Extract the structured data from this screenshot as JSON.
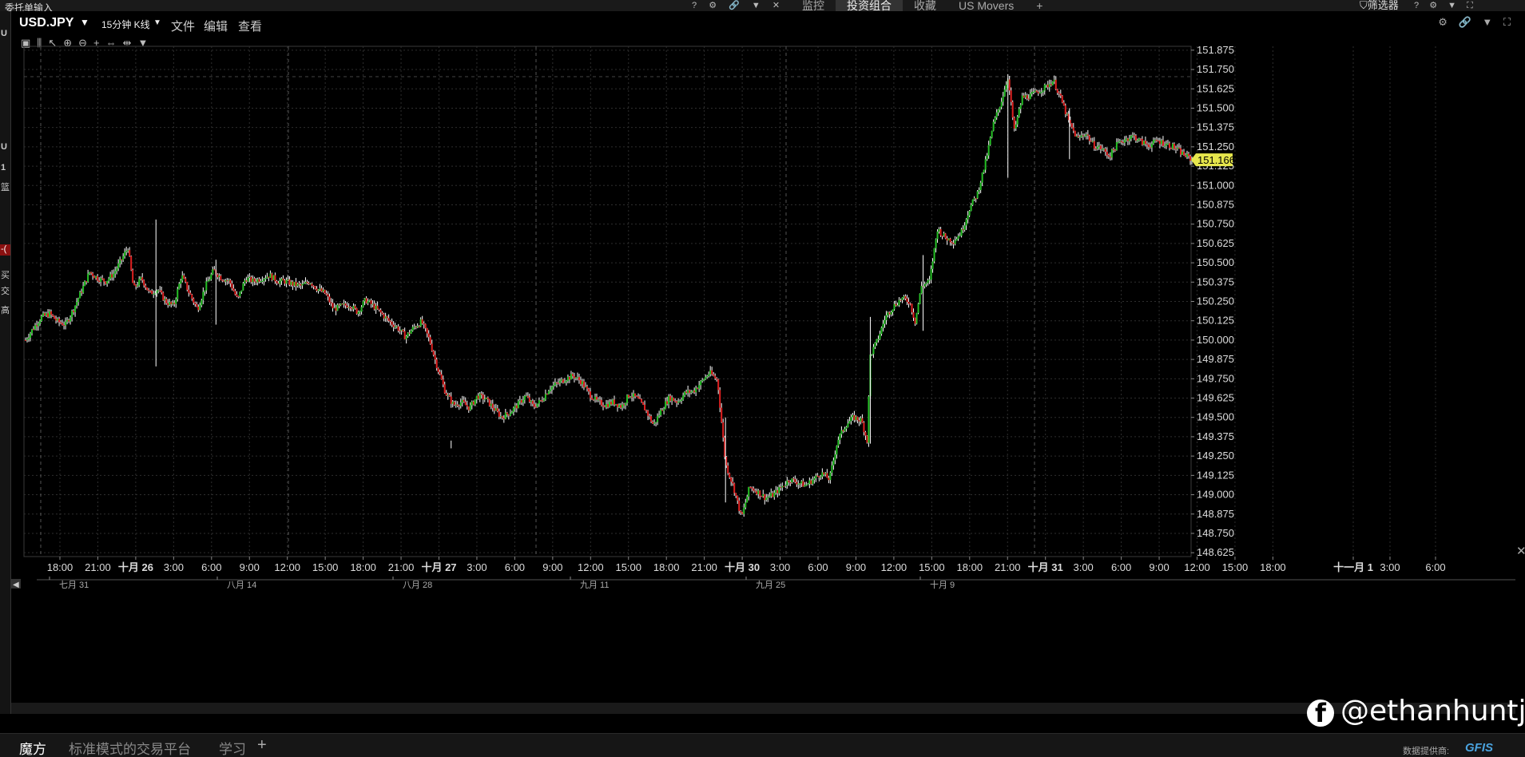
{
  "topbar": {
    "title": "委托单输入",
    "tabs": [
      {
        "label": "监控",
        "active": false
      },
      {
        "label": "投资组合",
        "active": true
      },
      {
        "label": "收藏",
        "active": false
      },
      {
        "label": "US Movers",
        "active": false
      }
    ],
    "screener_label": "筛选器"
  },
  "left_strip": {
    "texts": [
      "U",
      "1",
      "篮",
      "-(",
      "买",
      "交",
      "高"
    ]
  },
  "header": {
    "symbol": "USD.JPY",
    "interval": "15分钟 K线",
    "menus": [
      "文件",
      "编辑",
      "查看"
    ]
  },
  "chart_data": {
    "type": "candlestick",
    "symbol": "USD.JPY",
    "last_price": "151.166",
    "ylim": [
      148.6,
      151.9
    ],
    "y_ticks": [
      "151.875",
      "151.750",
      "151.625",
      "151.500",
      "151.375",
      "151.250",
      "151.125",
      "151.000",
      "150.875",
      "150.750",
      "150.625",
      "150.500",
      "150.375",
      "150.250",
      "150.125",
      "150.000",
      "149.875",
      "149.750",
      "149.625",
      "149.500",
      "149.375",
      "149.250",
      "149.125",
      "149.000",
      "148.875",
      "148.750",
      "148.625"
    ],
    "x_ticks": [
      "18:00",
      "21:00",
      "十月 26",
      "3:00",
      "6:00",
      "9:00",
      "12:00",
      "15:00",
      "18:00",
      "21:00",
      "十月 27",
      "3:00",
      "6:00",
      "9:00",
      "12:00",
      "15:00",
      "18:00",
      "21:00",
      "十月 30",
      "3:00",
      "6:00",
      "9:00",
      "12:00",
      "15:00",
      "18:00",
      "21:00",
      "十月 31",
      "3:00",
      "6:00",
      "9:00",
      "12:00",
      "15:00",
      "18:00",
      "十一月 1",
      "3:00",
      "6:00"
    ],
    "overview_labels": [
      "七月 31",
      "八月 14",
      "八月 28",
      "九月 11",
      "九月 25",
      "十月 9"
    ],
    "price_path": [
      [
        0,
        150.0
      ],
      [
        10,
        150.08
      ],
      [
        20,
        150.15
      ],
      [
        30,
        150.17
      ],
      [
        40,
        150.12
      ],
      [
        50,
        150.1
      ],
      [
        60,
        150.2
      ],
      [
        70,
        150.32
      ],
      [
        80,
        150.44
      ],
      [
        90,
        150.4
      ],
      [
        100,
        150.38
      ],
      [
        110,
        150.43
      ],
      [
        120,
        150.52
      ],
      [
        128,
        150.6
      ],
      [
        135,
        150.33
      ],
      [
        145,
        150.4
      ],
      [
        155,
        150.3
      ],
      [
        165,
        150.33
      ],
      [
        175,
        150.25
      ],
      [
        185,
        150.22
      ],
      [
        195,
        150.42
      ],
      [
        205,
        150.3
      ],
      [
        215,
        150.2
      ],
      [
        225,
        150.35
      ],
      [
        235,
        150.45
      ],
      [
        245,
        150.4
      ],
      [
        255,
        150.38
      ],
      [
        265,
        150.26
      ],
      [
        275,
        150.4
      ],
      [
        285,
        150.38
      ],
      [
        295,
        150.4
      ],
      [
        305,
        150.42
      ],
      [
        315,
        150.38
      ],
      [
        325,
        150.38
      ],
      [
        335,
        150.36
      ],
      [
        345,
        150.35
      ],
      [
        355,
        150.38
      ],
      [
        365,
        150.33
      ],
      [
        375,
        150.3
      ],
      [
        385,
        150.2
      ],
      [
        395,
        150.22
      ],
      [
        405,
        150.23
      ],
      [
        415,
        150.18
      ],
      [
        425,
        150.26
      ],
      [
        435,
        150.22
      ],
      [
        445,
        150.17
      ],
      [
        455,
        150.12
      ],
      [
        465,
        150.08
      ],
      [
        475,
        150.02
      ],
      [
        485,
        150.08
      ],
      [
        495,
        150.12
      ],
      [
        505,
        150.0
      ],
      [
        515,
        149.82
      ],
      [
        525,
        149.66
      ],
      [
        535,
        149.58
      ],
      [
        545,
        149.6
      ],
      [
        555,
        149.56
      ],
      [
        565,
        149.64
      ],
      [
        575,
        149.62
      ],
      [
        585,
        149.56
      ],
      [
        595,
        149.5
      ],
      [
        605,
        149.53
      ],
      [
        615,
        149.58
      ],
      [
        625,
        149.64
      ],
      [
        635,
        149.57
      ],
      [
        645,
        149.61
      ],
      [
        655,
        149.69
      ],
      [
        665,
        149.72
      ],
      [
        675,
        149.75
      ],
      [
        685,
        149.77
      ],
      [
        695,
        149.73
      ],
      [
        705,
        149.65
      ],
      [
        715,
        149.6
      ],
      [
        725,
        149.58
      ],
      [
        735,
        149.6
      ],
      [
        745,
        149.57
      ],
      [
        755,
        149.65
      ],
      [
        765,
        149.62
      ],
      [
        775,
        149.55
      ],
      [
        785,
        149.45
      ],
      [
        795,
        149.55
      ],
      [
        805,
        149.63
      ],
      [
        815,
        149.6
      ],
      [
        825,
        149.66
      ],
      [
        835,
        149.67
      ],
      [
        845,
        149.73
      ],
      [
        855,
        149.79
      ],
      [
        865,
        149.74
      ],
      [
        875,
        149.2
      ],
      [
        885,
        149.05
      ],
      [
        895,
        148.85
      ],
      [
        905,
        149.05
      ],
      [
        915,
        149.02
      ],
      [
        925,
        148.98
      ],
      [
        935,
        149.0
      ],
      [
        945,
        149.05
      ],
      [
        955,
        149.1
      ],
      [
        965,
        149.08
      ],
      [
        975,
        149.06
      ],
      [
        985,
        149.1
      ],
      [
        995,
        149.14
      ],
      [
        1005,
        149.1
      ],
      [
        1015,
        149.35
      ],
      [
        1025,
        149.45
      ],
      [
        1035,
        149.5
      ],
      [
        1045,
        149.48
      ],
      [
        1052,
        149.35
      ],
      [
        1056,
        149.9
      ],
      [
        1065,
        150.0
      ],
      [
        1075,
        150.15
      ],
      [
        1085,
        150.22
      ],
      [
        1095,
        150.27
      ],
      [
        1105,
        150.25
      ],
      [
        1112,
        150.12
      ],
      [
        1120,
        150.35
      ],
      [
        1130,
        150.38
      ],
      [
        1140,
        150.72
      ],
      [
        1150,
        150.66
      ],
      [
        1160,
        150.64
      ],
      [
        1170,
        150.7
      ],
      [
        1180,
        150.85
      ],
      [
        1190,
        150.95
      ],
      [
        1200,
        151.15
      ],
      [
        1210,
        151.4
      ],
      [
        1220,
        151.55
      ],
      [
        1228,
        151.7
      ],
      [
        1236,
        151.35
      ],
      [
        1246,
        151.57
      ],
      [
        1256,
        151.58
      ],
      [
        1266,
        151.61
      ],
      [
        1276,
        151.64
      ],
      [
        1285,
        151.68
      ],
      [
        1295,
        151.55
      ],
      [
        1305,
        151.4
      ],
      [
        1315,
        151.3
      ],
      [
        1325,
        151.34
      ],
      [
        1335,
        151.26
      ],
      [
        1345,
        151.24
      ],
      [
        1355,
        151.19
      ],
      [
        1365,
        151.27
      ],
      [
        1375,
        151.3
      ],
      [
        1385,
        151.32
      ],
      [
        1395,
        151.28
      ],
      [
        1405,
        151.26
      ],
      [
        1415,
        151.29
      ],
      [
        1425,
        151.27
      ],
      [
        1435,
        151.25
      ],
      [
        1445,
        151.21
      ],
      [
        1458,
        151.166
      ]
    ]
  },
  "bottom": {
    "tabs": [
      {
        "label": "魔方",
        "active": true
      },
      {
        "label": "标准模式的交易平台",
        "active": false
      },
      {
        "label": "学习",
        "active": false
      }
    ],
    "provider_label": "数据提供商:",
    "provider_logo": "GFIS"
  },
  "watermark": {
    "text": "@ethanhuntj"
  },
  "colors": {
    "up": "#25c025",
    "down": "#e02020",
    "last_price_bg": "#e6e64c",
    "grid": "#2e2e2e"
  }
}
